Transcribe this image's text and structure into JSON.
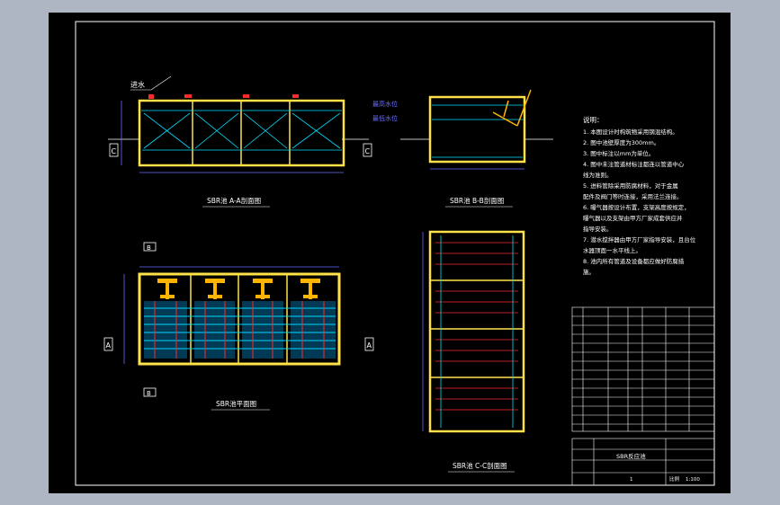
{
  "colors": {
    "background": "#adb6c2",
    "paper": "#000000",
    "frame": "#ffffff",
    "wall": "#ffe24a",
    "pipe": "#00e0ff",
    "section_arrow": "#ff2a2a",
    "dim": "#6b6bff",
    "label": "#ffffff",
    "valve": "#ffb400"
  },
  "section_a": {
    "title": "SBR池 A-A剖面图",
    "inlet_label": "进水",
    "mark_left": "C",
    "mark_right": "C"
  },
  "section_b": {
    "title": "SBR池 B-B剖面图",
    "high_water": "最高水位",
    "low_water": "最低水位"
  },
  "plan": {
    "title": "SBR池平面图",
    "mark_top": "B",
    "mark_bottom": "B",
    "mark_left": "A",
    "mark_right": "A"
  },
  "section_c": {
    "title": "SBR池 C-C剖面图"
  },
  "notes": {
    "heading": "说明：",
    "lines": [
      "1. 本图设计时构筑物采用钢混结构。",
      "2. 图中池壁厚度为300mm。",
      "3. 图中标注以mm为单位。",
      "4. 图中未注管道材标注都连以管道中心",
      "   线为准则。",
      "5. 进料管除采用防腐材料，对于金属",
      "   配件及阀门等时连接，采用法兰连接。",
      "6. 曝气器按设计布置，支架高度按规定，",
      "   曝气器以及支架由甲方厂家成套供应并",
      "   指导安装。",
      "7. 潜水搅拌器由甲方厂家指导安装，且台位",
      "   水器顶面一水平线上。",
      "8. 池内所有管道及设备都应做好防腐措",
      "   施。"
    ]
  },
  "title_block": {
    "drawing_name": "SBR反应池",
    "scale_label": "比例",
    "scale": "1:100",
    "sheet": "1"
  }
}
